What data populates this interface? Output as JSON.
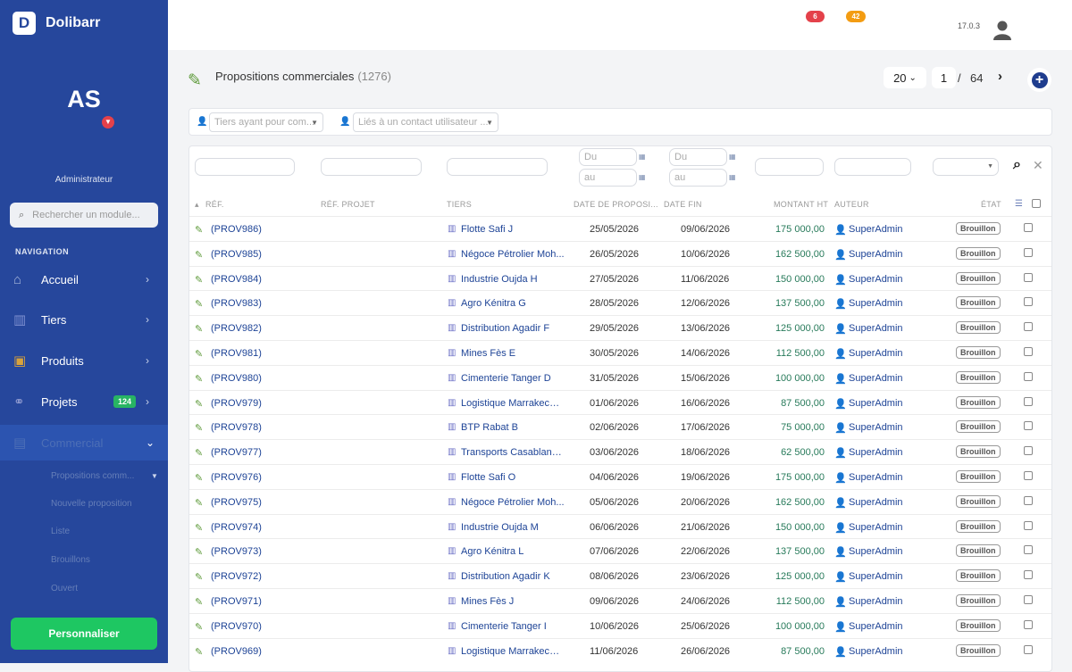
{
  "app": {
    "name": "Dolibarr",
    "logo_letter": "D",
    "version": "17.0.3"
  },
  "user": {
    "initials": "AS",
    "role": "Administrateur"
  },
  "sidebar": {
    "search_placeholder": "Rechercher un module...",
    "nav_title": "NAVIGATION",
    "items": [
      {
        "label": "Accueil",
        "icon": "home-icon"
      },
      {
        "label": "Tiers",
        "icon": "building-icon"
      },
      {
        "label": "Produits",
        "icon": "box-icon"
      },
      {
        "label": "Projets",
        "icon": "project-icon",
        "badge": "124"
      },
      {
        "label": "Commercial",
        "icon": "briefcase-icon"
      }
    ],
    "subitems": [
      "Propositions comm...",
      "Nouvelle proposition",
      "Liste",
      "Brouillons",
      "Ouvert"
    ],
    "customize": "Personnaliser"
  },
  "topbar": {
    "badge_red": "6",
    "badge_orange": "42"
  },
  "colors": {
    "sidebar": "#26479c",
    "accent_green": "#1ec762",
    "badge_red": "#e4414a",
    "badge_orange": "#f39c12"
  },
  "page": {
    "title": "Propositions commerciales",
    "count": "(1276)"
  },
  "pager": {
    "per_page": "20",
    "current": "1",
    "sep": "/",
    "total": "64"
  },
  "filters": {
    "tiers_placeholder": "Tiers ayant pour com...",
    "contact_placeholder": "Liés à un contact utilisateur ...",
    "du": "Du",
    "au": "au"
  },
  "columns": {
    "ref": "RÉF.",
    "ref_projet": "RÉF. PROJET",
    "tiers": "TIERS",
    "date": "DATE DE PROPOSI...",
    "date_fin": "DATE FIN",
    "montant": "MONTANT HT",
    "auteur": "AUTEUR",
    "etat": "ÉTAT"
  },
  "rows": [
    {
      "ref": "(PROV986)",
      "tiers": "Flotte Safi J",
      "date": "25/05/2026",
      "fin": "09/06/2026",
      "amount": "175 000,00",
      "author": "SuperAdmin",
      "state": "Brouillon"
    },
    {
      "ref": "(PROV985)",
      "tiers": "Négoce Pétrolier Moh...",
      "date": "26/05/2026",
      "fin": "10/06/2026",
      "amount": "162 500,00",
      "author": "SuperAdmin",
      "state": "Brouillon"
    },
    {
      "ref": "(PROV984)",
      "tiers": "Industrie Oujda H",
      "date": "27/05/2026",
      "fin": "11/06/2026",
      "amount": "150 000,00",
      "author": "SuperAdmin",
      "state": "Brouillon"
    },
    {
      "ref": "(PROV983)",
      "tiers": "Agro Kénitra G",
      "date": "28/05/2026",
      "fin": "12/06/2026",
      "amount": "137 500,00",
      "author": "SuperAdmin",
      "state": "Brouillon"
    },
    {
      "ref": "(PROV982)",
      "tiers": "Distribution Agadir F",
      "date": "29/05/2026",
      "fin": "13/06/2026",
      "amount": "125 000,00",
      "author": "SuperAdmin",
      "state": "Brouillon"
    },
    {
      "ref": "(PROV981)",
      "tiers": "Mines Fès E",
      "date": "30/05/2026",
      "fin": "14/06/2026",
      "amount": "112 500,00",
      "author": "SuperAdmin",
      "state": "Brouillon"
    },
    {
      "ref": "(PROV980)",
      "tiers": "Cimenterie Tanger D",
      "date": "31/05/2026",
      "fin": "15/06/2026",
      "amount": "100 000,00",
      "author": "SuperAdmin",
      "state": "Brouillon"
    },
    {
      "ref": "(PROV979)",
      "tiers": "Logistique Marrakech C",
      "date": "01/06/2026",
      "fin": "16/06/2026",
      "amount": "87 500,00",
      "author": "SuperAdmin",
      "state": "Brouillon"
    },
    {
      "ref": "(PROV978)",
      "tiers": "BTP Rabat B",
      "date": "02/06/2026",
      "fin": "17/06/2026",
      "amount": "75 000,00",
      "author": "SuperAdmin",
      "state": "Brouillon"
    },
    {
      "ref": "(PROV977)",
      "tiers": "Transports Casablanc...",
      "date": "03/06/2026",
      "fin": "18/06/2026",
      "amount": "62 500,00",
      "author": "SuperAdmin",
      "state": "Brouillon"
    },
    {
      "ref": "(PROV976)",
      "tiers": "Flotte Safi O",
      "date": "04/06/2026",
      "fin": "19/06/2026",
      "amount": "175 000,00",
      "author": "SuperAdmin",
      "state": "Brouillon"
    },
    {
      "ref": "(PROV975)",
      "tiers": "Négoce Pétrolier Moh...",
      "date": "05/06/2026",
      "fin": "20/06/2026",
      "amount": "162 500,00",
      "author": "SuperAdmin",
      "state": "Brouillon"
    },
    {
      "ref": "(PROV974)",
      "tiers": "Industrie Oujda M",
      "date": "06/06/2026",
      "fin": "21/06/2026",
      "amount": "150 000,00",
      "author": "SuperAdmin",
      "state": "Brouillon"
    },
    {
      "ref": "(PROV973)",
      "tiers": "Agro Kénitra L",
      "date": "07/06/2026",
      "fin": "22/06/2026",
      "amount": "137 500,00",
      "author": "SuperAdmin",
      "state": "Brouillon"
    },
    {
      "ref": "(PROV972)",
      "tiers": "Distribution Agadir K",
      "date": "08/06/2026",
      "fin": "23/06/2026",
      "amount": "125 000,00",
      "author": "SuperAdmin",
      "state": "Brouillon"
    },
    {
      "ref": "(PROV971)",
      "tiers": "Mines Fès J",
      "date": "09/06/2026",
      "fin": "24/06/2026",
      "amount": "112 500,00",
      "author": "SuperAdmin",
      "state": "Brouillon"
    },
    {
      "ref": "(PROV970)",
      "tiers": "Cimenterie Tanger I",
      "date": "10/06/2026",
      "fin": "25/06/2026",
      "amount": "100 000,00",
      "author": "SuperAdmin",
      "state": "Brouillon"
    },
    {
      "ref": "(PROV969)",
      "tiers": "Logistique Marrakech H",
      "date": "11/06/2026",
      "fin": "26/06/2026",
      "amount": "87 500,00",
      "author": "SuperAdmin",
      "state": "Brouillon"
    }
  ]
}
